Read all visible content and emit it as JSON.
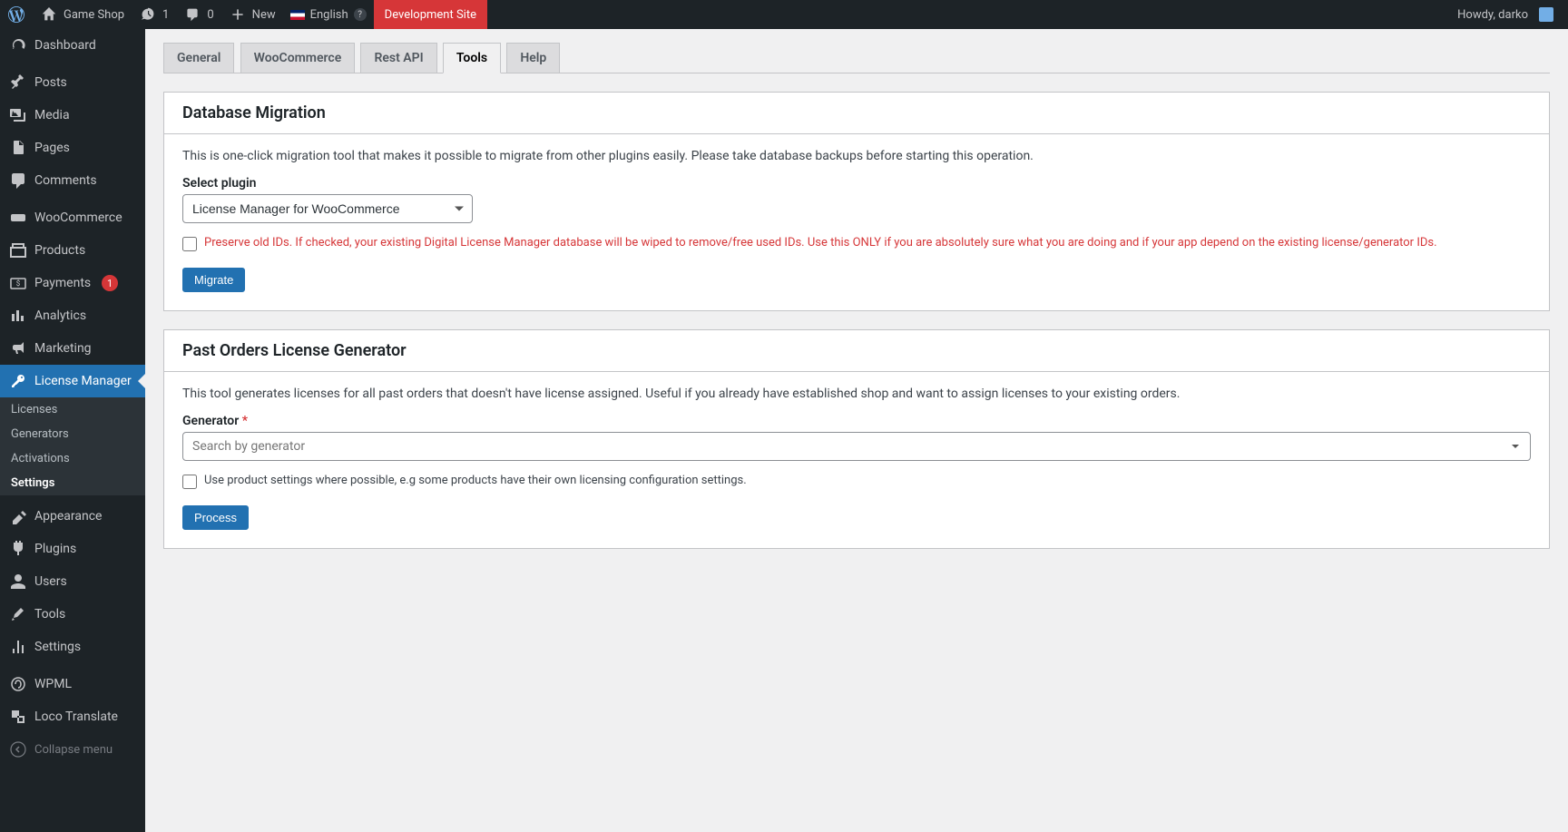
{
  "adminbar": {
    "site_name": "Game Shop",
    "updates": "1",
    "comments": "0",
    "new_label": "New",
    "language": "English",
    "dev_site": "Development Site",
    "howdy": "Howdy, darko"
  },
  "sidebar": {
    "dashboard": "Dashboard",
    "posts": "Posts",
    "media": "Media",
    "pages": "Pages",
    "comments": "Comments",
    "woocommerce": "WooCommerce",
    "products": "Products",
    "payments": "Payments",
    "payments_count": "1",
    "analytics": "Analytics",
    "marketing": "Marketing",
    "license_manager": "License Manager",
    "lm_licenses": "Licenses",
    "lm_generators": "Generators",
    "lm_activations": "Activations",
    "lm_settings": "Settings",
    "appearance": "Appearance",
    "plugins": "Plugins",
    "users": "Users",
    "tools": "Tools",
    "settings": "Settings",
    "wpml": "WPML",
    "loco": "Loco Translate",
    "collapse": "Collapse menu"
  },
  "tabs": {
    "general": "General",
    "woocommerce": "WooCommerce",
    "rest_api": "Rest API",
    "tools": "Tools",
    "help": "Help"
  },
  "migration": {
    "title": "Database Migration",
    "description": "This is one-click migration tool that makes it possible to migrate from other plugins easily. Please take database backups before starting this operation.",
    "select_plugin_label": "Select plugin",
    "select_plugin_value": "License Manager for WooCommerce",
    "preserve_ids_label": "Preserve old IDs. If checked, your existing Digital License Manager database will be wiped to remove/free used IDs. Use this ONLY if you are absolutely sure what you are doing and if your app depend on the existing license/generator IDs.",
    "migrate_button": "Migrate"
  },
  "generator": {
    "title": "Past Orders License Generator",
    "description": "This tool generates licenses for all past orders that doesn't have license assigned. Useful if you already have established shop and want to assign licenses to your existing orders.",
    "generator_label": "Generator",
    "generator_placeholder": "Search by generator",
    "use_product_label": "Use product settings where possible, e.g some products have their own licensing configuration settings.",
    "process_button": "Process"
  }
}
